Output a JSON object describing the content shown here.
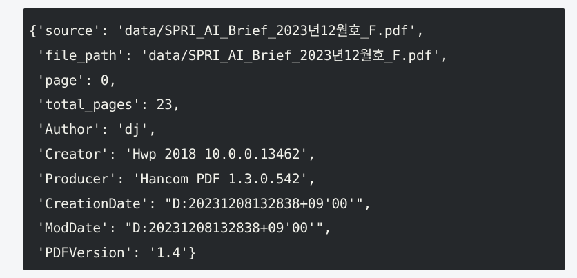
{
  "code": {
    "lines": [
      "{'source': 'data/SPRI_AI_Brief_2023년12월호_F.pdf',",
      " 'file_path': 'data/SPRI_AI_Brief_2023년12월호_F.pdf',",
      " 'page': 0,",
      " 'total_pages': 23,",
      " 'Author': 'dj',",
      " 'Creator': 'Hwp 2018 10.0.0.13462',",
      " 'Producer': 'Hancom PDF 1.3.0.542',",
      " 'CreationDate': \"D:20231208132838+09'00'\",",
      " 'ModDate': \"D:20231208132838+09'00'\",",
      " 'PDFVersion': '1.4'}"
    ]
  },
  "colors": {
    "panel_background": "#25282b",
    "text": "#f1f1ea",
    "page_background": "#f5f6f8"
  }
}
